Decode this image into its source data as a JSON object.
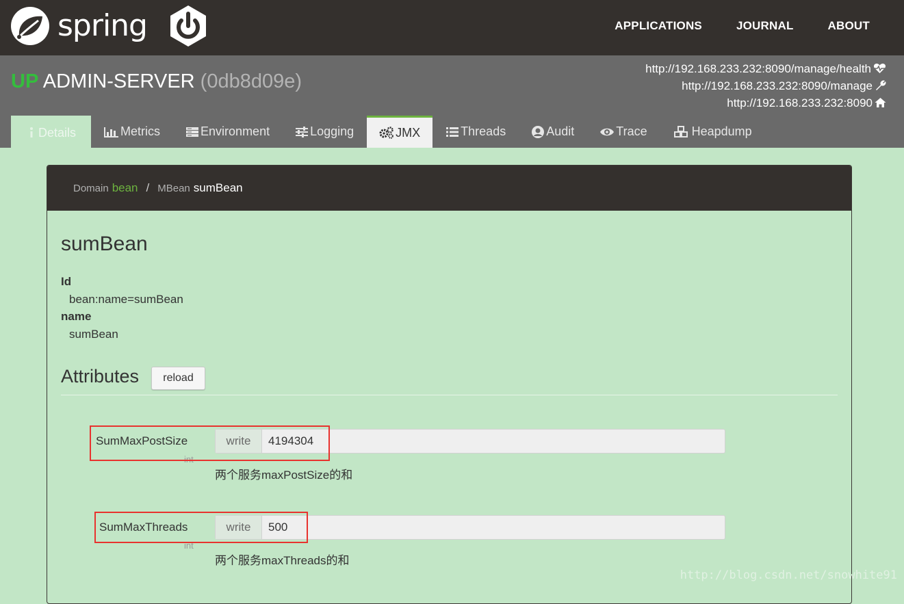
{
  "brand": {
    "name": "spring"
  },
  "nav": {
    "applications": "APPLICATIONS",
    "journal": "JOURNAL",
    "about": "ABOUT"
  },
  "app": {
    "status": "UP",
    "name": "ADMIN-SERVER",
    "id": "(0db8d09e)",
    "urls": {
      "health": "http://192.168.233.232:8090/manage/health",
      "manage": "http://192.168.233.232:8090/manage",
      "home": "http://192.168.233.232:8090"
    }
  },
  "tabs": [
    {
      "label": "Details",
      "icon": "info-icon"
    },
    {
      "label": "Metrics",
      "icon": "bar-chart-icon"
    },
    {
      "label": "Environment",
      "icon": "server-icon"
    },
    {
      "label": "Logging",
      "icon": "sliders-icon"
    },
    {
      "label": "JMX",
      "icon": "gears-icon",
      "active": true
    },
    {
      "label": "Threads",
      "icon": "list-icon"
    },
    {
      "label": "Audit",
      "icon": "user-circle-icon"
    },
    {
      "label": "Trace",
      "icon": "eye-icon"
    },
    {
      "label": "Heapdump",
      "icon": "cubes-icon"
    }
  ],
  "breadcrumb": {
    "domain_label": "Domain",
    "domain": "bean",
    "sep": "/",
    "mbean_label": "MBean",
    "mbean": "sumBean"
  },
  "bean": {
    "title": "sumBean",
    "props": [
      {
        "key": "Id",
        "value": "bean:name=sumBean"
      },
      {
        "key": "name",
        "value": "sumBean"
      }
    ]
  },
  "attributes": {
    "title": "Attributes",
    "reload": "reload",
    "items": [
      {
        "name": "SumMaxPostSize",
        "type": "int",
        "addon": "write",
        "value": "4194304",
        "desc": "两个服务maxPostSize的和"
      },
      {
        "name": "SumMaxThreads",
        "type": "int",
        "addon": "write",
        "value": "500",
        "desc": "两个服务maxThreads的和"
      }
    ]
  },
  "watermark": "http://blog.csdn.net/snowhite91",
  "colors": {
    "spring_green": "#6db33f",
    "status_up": "#34bd3d",
    "navbar": "#34302d",
    "page_bg": "#c2e6c6",
    "highlight": "#e8322e"
  }
}
